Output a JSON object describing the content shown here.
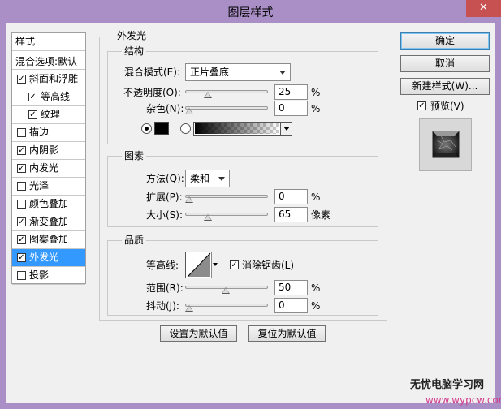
{
  "window": {
    "title": "图层样式",
    "close_glyph": "✕"
  },
  "style_list": {
    "header": "样式",
    "blend_options": "混合选项:默认",
    "items": [
      {
        "label": "斜面和浮雕",
        "checked": true,
        "indent": false,
        "selected": false
      },
      {
        "label": "等高线",
        "checked": true,
        "indent": true,
        "selected": false
      },
      {
        "label": "纹理",
        "checked": true,
        "indent": true,
        "selected": false
      },
      {
        "label": "描边",
        "checked": false,
        "indent": false,
        "selected": false
      },
      {
        "label": "内阴影",
        "checked": true,
        "indent": false,
        "selected": false
      },
      {
        "label": "内发光",
        "checked": true,
        "indent": false,
        "selected": false
      },
      {
        "label": "光泽",
        "checked": false,
        "indent": false,
        "selected": false
      },
      {
        "label": "颜色叠加",
        "checked": false,
        "indent": false,
        "selected": false
      },
      {
        "label": "渐变叠加",
        "checked": true,
        "indent": false,
        "selected": false
      },
      {
        "label": "图案叠加",
        "checked": true,
        "indent": false,
        "selected": false
      },
      {
        "label": "外发光",
        "checked": true,
        "indent": false,
        "selected": true
      },
      {
        "label": "投影",
        "checked": false,
        "indent": false,
        "selected": false
      }
    ]
  },
  "outer_glow": {
    "title": "外发光",
    "structure": {
      "title": "结构",
      "blend_mode_label": "混合模式(E):",
      "blend_mode_value": "正片叠底",
      "opacity_label": "不透明度(O):",
      "opacity_value": "25",
      "opacity_level": 0.25,
      "noise_label": "杂色(N):",
      "noise_value": "0",
      "noise_level": 0,
      "percent": "%",
      "color_radio": "solid",
      "glow_color": "#000000"
    },
    "elements": {
      "title": "图素",
      "technique_label": "方法(Q):",
      "technique_value": "柔和",
      "spread_label": "扩展(P):",
      "spread_value": "0",
      "spread_level": 0,
      "size_label": "大小(S):",
      "size_value": "65",
      "size_level": 0.26,
      "percent": "%",
      "pixels": "像素"
    },
    "quality": {
      "title": "品质",
      "contour_label": "等高线:",
      "antialias_label": "消除锯齿(L)",
      "antialias_checked": true,
      "range_label": "范围(R):",
      "range_value": "50",
      "range_level": 0.5,
      "jitter_label": "抖动(J):",
      "jitter_value": "0",
      "jitter_level": 0,
      "percent": "%"
    },
    "set_default": "设置为默认值",
    "reset_default": "复位为默认值"
  },
  "buttons": {
    "ok": "确定",
    "cancel": "取消",
    "new_style": "新建样式(W)...",
    "preview_label": "预览(V)",
    "preview_checked": true
  },
  "watermark": {
    "line1": "无忧电脑学习网",
    "line2": "www.wypcw.com"
  },
  "colors": {
    "title_bar": "#a98fc6",
    "selection": "#3399ff"
  }
}
